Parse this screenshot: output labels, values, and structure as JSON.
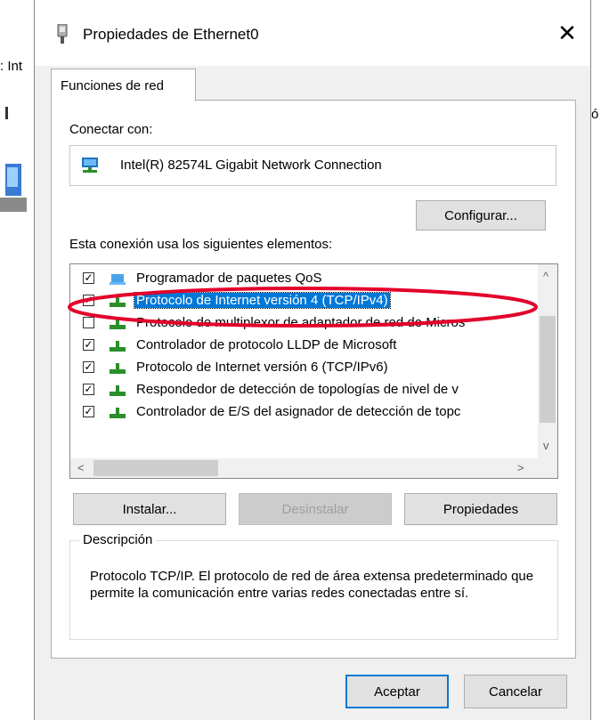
{
  "background": {
    "partial_text": ": Int",
    "partial_text_right": "ó"
  },
  "dialog": {
    "title": "Propiedades de Ethernet0",
    "close_label": "✕",
    "tab_label": "Funciones de red",
    "connect_label": "Conectar con:",
    "adapter_name": "Intel(R) 82574L Gigabit Network Connection",
    "configure_label": "Configurar...",
    "items_label": "Esta conexión usa los siguientes elementos:",
    "items": [
      {
        "label": "Programador de paquetes QoS",
        "checked": true,
        "icon": "network-client-icon"
      },
      {
        "label": "Protocolo de Internet versión 4 (TCP/IPv4)",
        "checked": true,
        "selected": true,
        "icon": "protocol-icon"
      },
      {
        "label": "Protocolo de multiplexor de adaptador de red de Micros",
        "checked": false,
        "icon": "protocol-icon"
      },
      {
        "label": "Controlador de protocolo LLDP de Microsoft",
        "checked": true,
        "icon": "protocol-icon"
      },
      {
        "label": "Protocolo de Internet versión 6 (TCP/IPv6)",
        "checked": true,
        "icon": "protocol-icon"
      },
      {
        "label": "Respondedor de detección de topologías de nivel de v",
        "checked": true,
        "icon": "protocol-icon"
      },
      {
        "label": "Controlador de E/S del asignador de detección de topc",
        "checked": true,
        "icon": "protocol-icon"
      }
    ],
    "install_label": "Instalar...",
    "uninstall_label": "Desinstalar",
    "properties_label": "Propiedades",
    "description_legend": "Descripción",
    "description_text": "Protocolo TCP/IP. El protocolo de red de área extensa predeterminado que permite la comunicación entre varias redes conectadas entre sí.",
    "ok_label": "Aceptar",
    "cancel_label": "Cancelar"
  },
  "colors": {
    "selection": "#0078d7",
    "annotation": "#e3002b"
  }
}
